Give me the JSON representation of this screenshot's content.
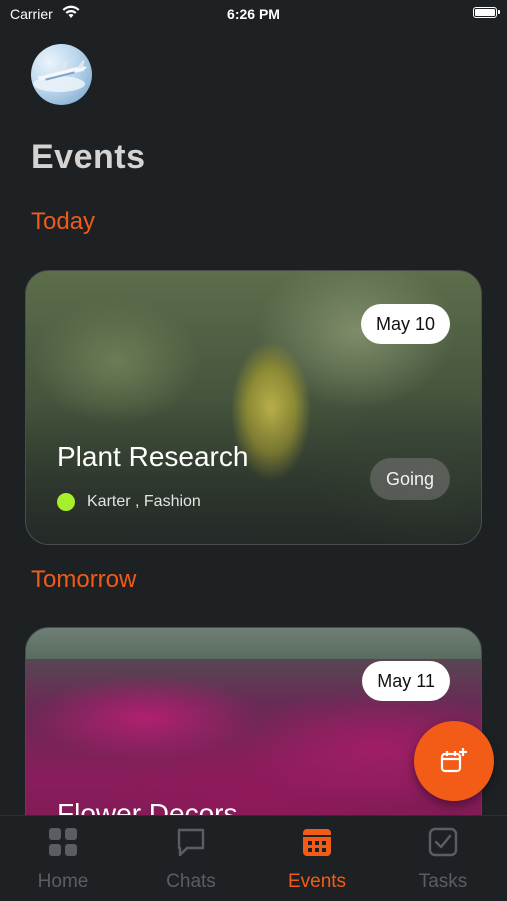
{
  "status_bar": {
    "carrier": "Carrier",
    "time": "6:26 PM"
  },
  "header": {
    "title": "Events"
  },
  "sections": {
    "today": {
      "label": "Today",
      "event": {
        "date": "May 10",
        "title": "Plant Research",
        "meta": "Karter , Fashion",
        "status": "Going",
        "dot_color": "#a6ef2a"
      }
    },
    "tomorrow": {
      "label": "Tomorrow",
      "event": {
        "date": "May 11",
        "title": "Flower Decors"
      }
    }
  },
  "tabs": [
    {
      "label": "Home",
      "icon": "grid-icon"
    },
    {
      "label": "Chats",
      "icon": "chat-bubble-icon"
    },
    {
      "label": "Events",
      "icon": "calendar-icon",
      "active": true
    },
    {
      "label": "Tasks",
      "icon": "checkbox-icon"
    }
  ],
  "fab": {
    "icon": "add-event-icon"
  },
  "colors": {
    "accent": "#f35c17",
    "background": "#1e2124",
    "inactive_tab": "#5a5e62"
  }
}
